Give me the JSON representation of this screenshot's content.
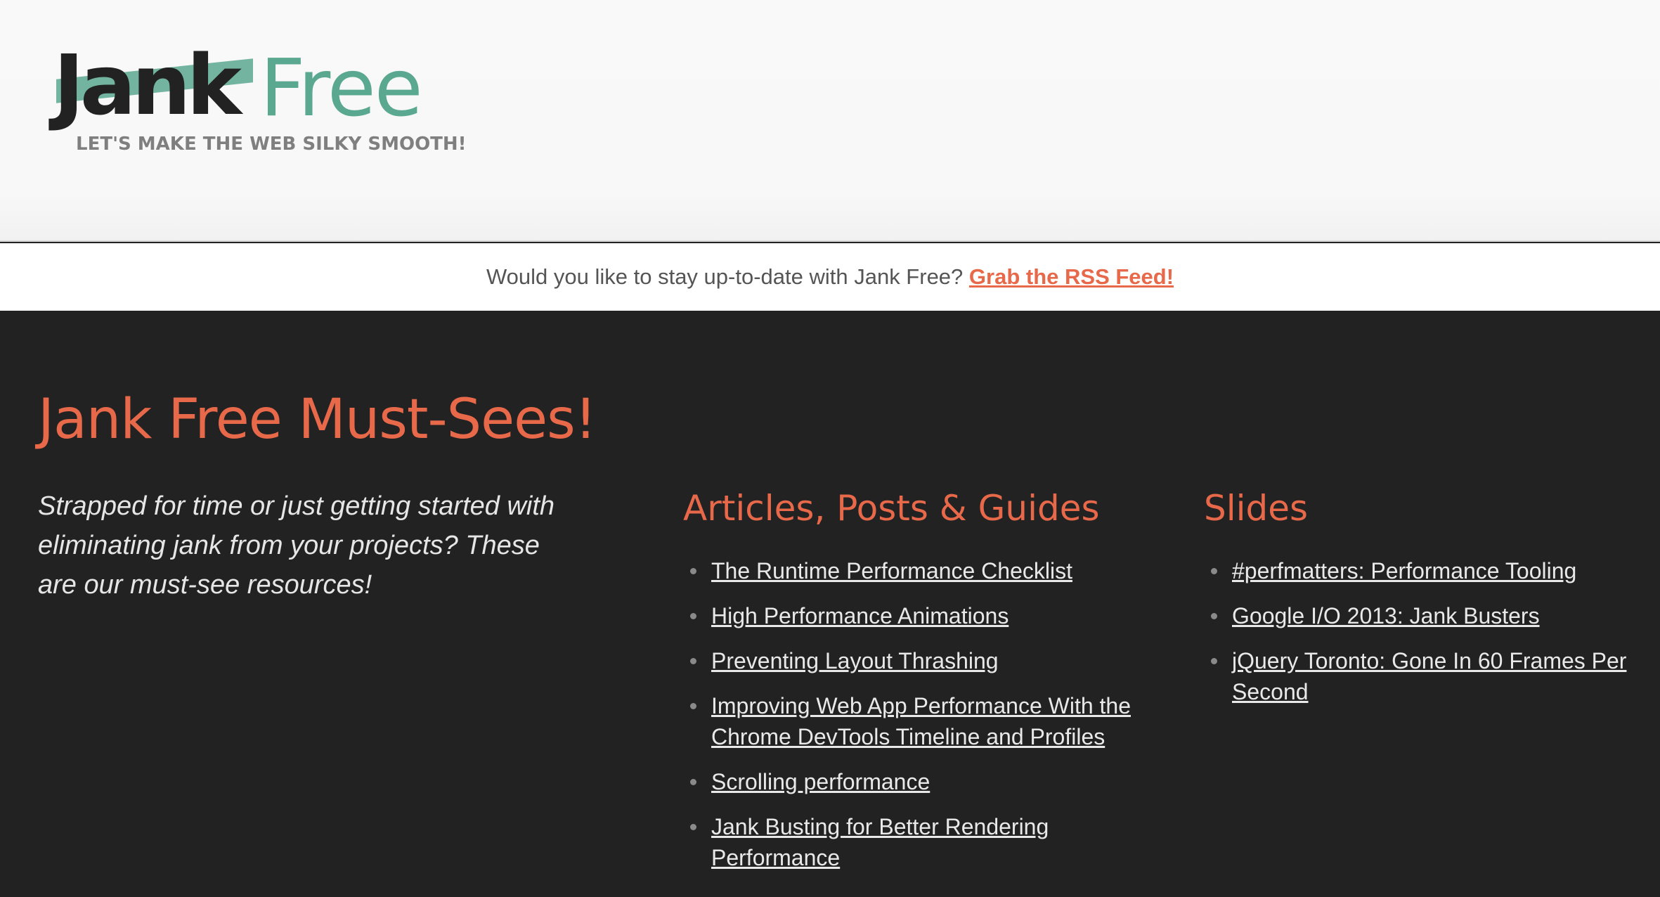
{
  "header": {
    "logo": {
      "word1": "Jank",
      "word2": "Free",
      "tagline": "LET'S MAKE THE WEB SILKY SMOOTH!"
    }
  },
  "rss": {
    "prompt": "Would you like to stay up-to-date with Jank Free?",
    "link_label": "Grab the RSS Feed!"
  },
  "main": {
    "title": "Jank Free Must-Sees!",
    "intro": "Strapped for time or just getting started with eliminating jank from your projects? These are our must-see resources!",
    "articles": {
      "heading": "Articles, Posts & Guides",
      "items": [
        "The Runtime Performance Checklist",
        "High Performance Animations",
        "Preventing Layout Thrashing",
        "Improving Web App Performance With the Chrome DevTools Timeline and Profiles",
        "Scrolling performance",
        "Jank Busting for Better Rendering Performance"
      ]
    },
    "slides": {
      "heading": "Slides",
      "items": [
        "#perfmatters: Performance Tooling",
        "Google I/O 2013: Jank Busters",
        "jQuery Toronto: Gone In 60 Frames Per Second"
      ]
    }
  },
  "colors": {
    "accent": "#e8694a",
    "brand_green": "#5aa88f",
    "dark_bg": "#222222"
  }
}
